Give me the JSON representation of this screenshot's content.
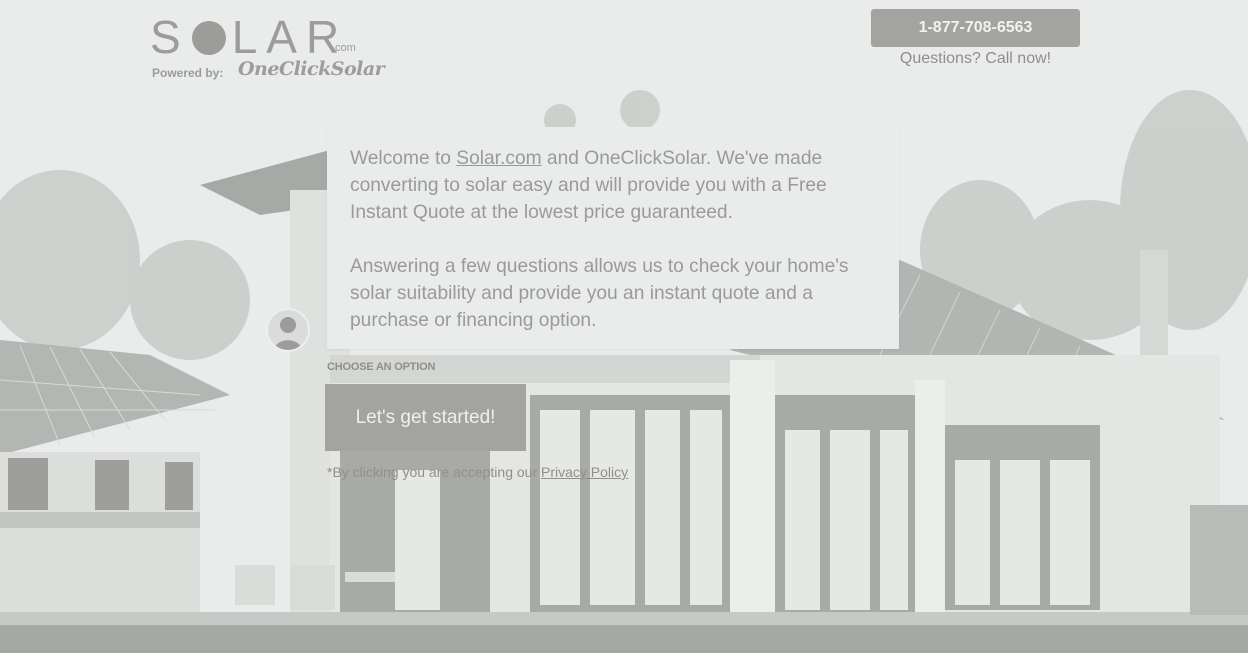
{
  "header": {
    "logo": {
      "word": "S",
      "word_rest": "LAR",
      "tld": ".com"
    },
    "powered_by_label": "Powered by:",
    "powered_by_brand": "OneClickSolar",
    "phone_button_label": "1-877-708-6563",
    "call_now_text": "Questions? Call now!"
  },
  "chat": {
    "welcome_prefix": "Welcome to ",
    "welcome_link": "Solar.com",
    "welcome_suffix": " and OneClickSolar. We've made converting to solar easy and will provide you with a Free Instant Quote at the lowest price guaranteed.",
    "paragraph_2": "Answering a few questions allows us to check your home's solar suitability and provide you an instant quote and a purchase or financing option.",
    "choose_label": "CHOOSE AN OPTION",
    "start_button_label": "Let's get started!",
    "disclaimer_prefix": "*By clicking you are accepting our ",
    "disclaimer_link": "Privacy Policy"
  },
  "colors": {
    "background": "#e9eceb",
    "button": "#a3a39f",
    "text": "#9a9a96"
  }
}
